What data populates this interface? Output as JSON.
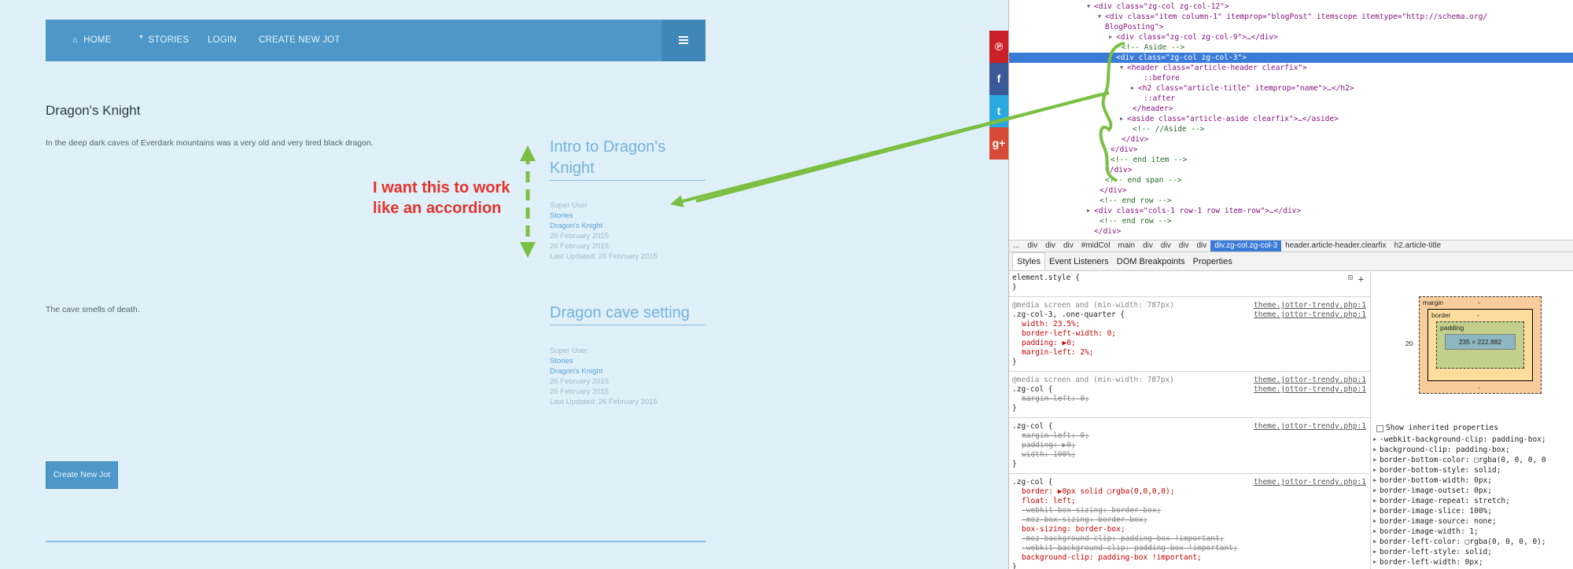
{
  "nav": {
    "items": [
      {
        "label": "HOME",
        "icon": "home-icon"
      },
      {
        "label": "STORIES",
        "icon": "caret-down-icon"
      },
      {
        "label": "LOGIN"
      },
      {
        "label": "CREATE NEW JOT"
      }
    ],
    "menu_icon": "hamburger-icon"
  },
  "article": {
    "title": "Dragon's Knight",
    "paragraphs": [
      "In the deep dark caves of Everdark mountains was a very old and very tired black dragon.",
      "The cave smells of death."
    ]
  },
  "asides": [
    {
      "title": "Intro to Dragon's Knight",
      "author": "Super User",
      "category": "Stories",
      "parent": "Dragon's Knight",
      "created": "26 February 2015",
      "published": "26 February 2015",
      "updated": "Last Updated: 26 February 2015"
    },
    {
      "title": "Dragon cave setting",
      "author": "Super User",
      "category": "Stories",
      "parent": "Dragon's Knight",
      "created": "26 February 2015",
      "published": "26 February 2015",
      "updated": "Last Updated: 26 February 2015"
    }
  ],
  "annotation": {
    "line1": "I want this to work",
    "line2": "like an accordion",
    "color": "#e4322b"
  },
  "create_button": "Create New Jot",
  "social": [
    {
      "icon": "pinterest-icon",
      "glyph": "℗",
      "color": "#cb2027"
    },
    {
      "icon": "facebook-icon",
      "glyph": "f",
      "color": "#3b5998"
    },
    {
      "icon": "twitter-icon",
      "glyph": "t",
      "color": "#2aa9e0"
    },
    {
      "icon": "google-plus-icon",
      "glyph": "g+",
      "color": "#d84a38"
    }
  ],
  "dom_lines": [
    {
      "indent": 12,
      "arrow": "▼",
      "kind": "tag",
      "text": "<div class=\"zg-col zg-col-12\">"
    },
    {
      "indent": 14,
      "arrow": "▼",
      "kind": "tag",
      "text": "<div class=\"item column-1\" itemprop=\"blogPost\" itemscope itemtype=\"http://schema.org/"
    },
    {
      "indent": 14,
      "arrow": "",
      "kind": "tag",
      "text": "BlogPosting\">"
    },
    {
      "indent": 16,
      "arrow": "▶",
      "kind": "tag",
      "text": "<div class=\"zg-col zg-col-9\">…</div>"
    },
    {
      "indent": 17,
      "arrow": "",
      "kind": "cmt",
      "text": "<!-- Aside -->"
    },
    {
      "indent": 16,
      "arrow": "▼",
      "kind": "sel",
      "text": "<div class=\"zg-col zg-col-3\">"
    },
    {
      "indent": 18,
      "arrow": "▼",
      "kind": "tag",
      "text": "<header class=\"article-header clearfix\">"
    },
    {
      "indent": 21,
      "arrow": "",
      "kind": "tag",
      "text": "::before"
    },
    {
      "indent": 20,
      "arrow": "▶",
      "kind": "tag",
      "text": "<h2 class=\"article-title\" itemprop=\"name\">…</h2>"
    },
    {
      "indent": 21,
      "arrow": "",
      "kind": "tag",
      "text": "::after"
    },
    {
      "indent": 19,
      "arrow": "",
      "kind": "tag",
      "text": "</header>"
    },
    {
      "indent": 18,
      "arrow": "▶",
      "kind": "tag",
      "text": "<aside class=\"article-aside clearfix\">…</aside>"
    },
    {
      "indent": 19,
      "arrow": "",
      "kind": "cmt",
      "text": "<!-- //Aside -->"
    },
    {
      "indent": 17,
      "arrow": "",
      "kind": "tag",
      "text": "</div>"
    },
    {
      "indent": 15,
      "arrow": "",
      "kind": "tag",
      "text": "</div>"
    },
    {
      "indent": 15,
      "arrow": "",
      "kind": "cmt",
      "text": "<!-- end item -->"
    },
    {
      "indent": 14,
      "arrow": "",
      "kind": "tag",
      "text": "</div>"
    },
    {
      "indent": 14,
      "arrow": "",
      "kind": "cmt",
      "text": "<!-- end span -->"
    },
    {
      "indent": 13,
      "arrow": "",
      "kind": "tag",
      "text": "</div>"
    },
    {
      "indent": 13,
      "arrow": "",
      "kind": "cmt",
      "text": "<!-- end row -->"
    },
    {
      "indent": 12,
      "arrow": "▶",
      "kind": "tag",
      "text": "<div class=\"cols-1 row-1 row item-row\">…</div>"
    },
    {
      "indent": 13,
      "arrow": "",
      "kind": "cmt",
      "text": "<!-- end row -->"
    },
    {
      "indent": 12,
      "arrow": "",
      "kind": "tag",
      "text": "</div>"
    }
  ],
  "breadcrumbs": [
    "...",
    "div",
    "div",
    "div",
    "#midCol",
    "main",
    "div",
    "div",
    "div",
    "div",
    "div.zg-col.zg-col-3",
    "header.article-header.clearfix",
    "h2.article-title"
  ],
  "active_crumb": 10,
  "tabs": [
    "Styles",
    "Event Listeners",
    "DOM Breakpoints",
    "Properties"
  ],
  "style_rules": [
    {
      "lines": [
        [
          "sel",
          "element.style {"
        ],
        [
          "sel",
          "}"
        ]
      ],
      "source": ""
    },
    {
      "lines": [
        [
          "gray",
          "@media screen and (min-width: 787px)"
        ],
        [
          "sel",
          ".zg-col-3, .one-quarter {"
        ],
        [
          "prop",
          "width: 23.5%;"
        ],
        [
          "prop",
          "border-left-width: 0;"
        ],
        [
          "prop",
          "padding: ▶0;"
        ],
        [
          "prop",
          "margin-left: 2%;"
        ],
        [
          "sel",
          "}"
        ]
      ],
      "source": "theme.jottor-trendy.php:1"
    },
    {
      "lines": [
        [
          "gray",
          "@media screen and (min-width: 787px)"
        ],
        [
          "sel",
          ".zg-col {"
        ],
        [
          "strike",
          "margin-left: 0;"
        ],
        [
          "sel",
          "}"
        ]
      ],
      "source": "theme.jottor-trendy.php:1"
    },
    {
      "lines": [
        [
          "sel",
          ".zg-col {"
        ],
        [
          "strike",
          "margin-left: 0;"
        ],
        [
          "strike",
          "padding: ▶0;"
        ],
        [
          "strike",
          "width: 100%;"
        ],
        [
          "sel",
          "}"
        ]
      ],
      "source": "theme.jottor-trendy.php:1"
    },
    {
      "lines": [
        [
          "sel",
          ".zg-col {"
        ],
        [
          "prop",
          "border: ▶0px solid ▢rgba(0,0,0,0);"
        ],
        [
          "prop",
          "float: left;"
        ],
        [
          "strike",
          "-webkit-box-sizing: border-box;"
        ],
        [
          "strike",
          "-moz-box-sizing: border-box;"
        ],
        [
          "prop",
          "box-sizing: border-box;"
        ],
        [
          "strike",
          "-moz-background-clip: padding-box !important;"
        ],
        [
          "strike",
          "-webkit-background-clip: padding-box !important;"
        ],
        [
          "prop",
          "background-clip: padding-box !important;"
        ],
        [
          "sel",
          "}"
        ]
      ],
      "source": "theme.jottor-trendy.php:1"
    }
  ],
  "style_sources": [
    "theme.jottor-trendy.php:1",
    "theme.jottor-trendy.php:1",
    "theme.jottor-trendy.php:1",
    "theme.jottor-trendy.php:1",
    "theme.jottor-trendy.php:1",
    "theme.jottor-trendy.php:1",
    "theme.jottor-trendy.php:1"
  ],
  "box_model": {
    "margin": "margin",
    "border": "border",
    "padding": "padding",
    "content": "235 × 222.882",
    "dash": "-",
    "left": "20"
  },
  "show_inherited": "Show inherited properties",
  "computed": [
    "-webkit-background-clip: padding-box;",
    "background-clip: padding-box;",
    "border-bottom-color: ▢rgba(0, 0, 0, 0",
    "border-bottom-style: solid;",
    "border-bottom-width: 0px;",
    "border-image-outset: 0px;",
    "border-image-repeat: stretch;",
    "border-image-slice: 100%;",
    "border-image-source: none;",
    "border-image-width: 1;",
    "border-left-color: ▢rgba(0, 0, 0, 0);",
    "border-left-style: solid;",
    "border-left-width: 0px;"
  ]
}
